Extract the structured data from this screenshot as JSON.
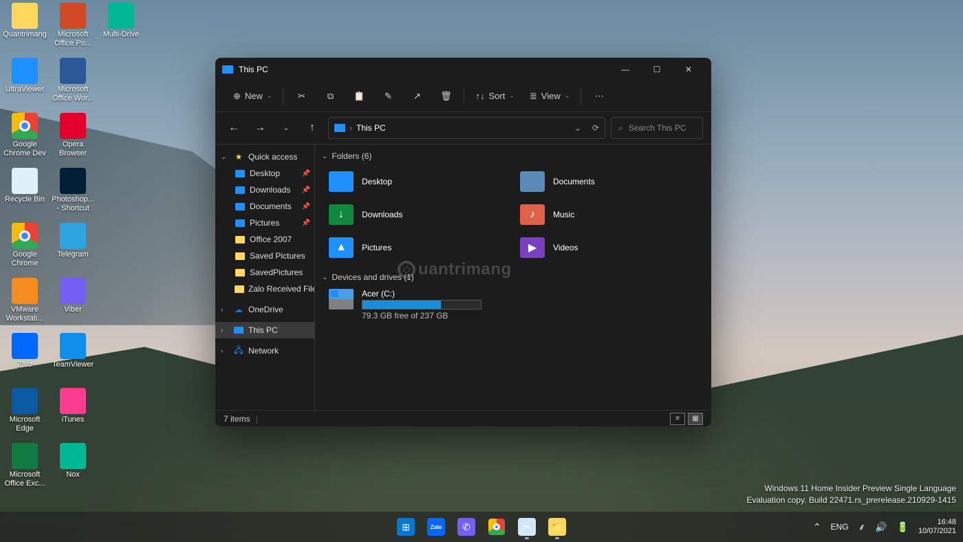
{
  "desktop_icons": [
    {
      "label": "Quantrimang",
      "col": 0,
      "row": 0,
      "color": "#ffd75e"
    },
    {
      "label": "Microsoft Office Po...",
      "col": 1,
      "row": 0,
      "color": "#d04a26"
    },
    {
      "label": "Multi-Drive",
      "col": 2,
      "row": 0,
      "color": "#00b894"
    },
    {
      "label": "UltraViewer",
      "col": 0,
      "row": 1,
      "color": "#1e90ff"
    },
    {
      "label": "Microsoft Office Wor...",
      "col": 1,
      "row": 1,
      "color": "#2b5797"
    },
    {
      "label": "Google Chrome Dev",
      "col": 0,
      "row": 2,
      "color": "chrome"
    },
    {
      "label": "Opera Browser",
      "col": 1,
      "row": 2,
      "color": "#e3002b"
    },
    {
      "label": "Recycle Bin",
      "col": 0,
      "row": 3,
      "color": "#e0f0f8"
    },
    {
      "label": "Photoshop... - Shortcut",
      "col": 1,
      "row": 3,
      "color": "#001e36"
    },
    {
      "label": "Google Chrome",
      "col": 0,
      "row": 4,
      "color": "chrome"
    },
    {
      "label": "Telegram",
      "col": 1,
      "row": 4,
      "color": "#2ca5e0"
    },
    {
      "label": "VMware Workstati...",
      "col": 0,
      "row": 5,
      "color": "#f68b1f"
    },
    {
      "label": "Viber",
      "col": 1,
      "row": 5,
      "color": "#7360f2"
    },
    {
      "label": "Zalo",
      "col": 0,
      "row": 6,
      "color": "#0068ff"
    },
    {
      "label": "TeamViewer",
      "col": 1,
      "row": 6,
      "color": "#0e8ee9"
    },
    {
      "label": "Microsoft Edge",
      "col": 0,
      "row": 7,
      "color": "#0c59a4"
    },
    {
      "label": "iTunes",
      "col": 1,
      "row": 7,
      "color": "#fc3c8f"
    },
    {
      "label": "Microsoft Office Exc...",
      "col": 0,
      "row": 8,
      "color": "#107c41"
    },
    {
      "label": "Nox",
      "col": 1,
      "row": 8,
      "color": "#00b894"
    }
  ],
  "explorer": {
    "title": "This PC",
    "toolbar": {
      "new": "New",
      "sort": "Sort",
      "view": "View"
    },
    "address": {
      "location": "This PC"
    },
    "search": {
      "placeholder": "Search This PC"
    },
    "nav": {
      "quick_access": "Quick access",
      "items": [
        {
          "label": "Desktop",
          "pinned": true,
          "color": "#1e90ff"
        },
        {
          "label": "Downloads",
          "pinned": true,
          "color": "#1e90ff",
          "glyph": "↓"
        },
        {
          "label": "Documents",
          "pinned": true,
          "color": "#1e90ff"
        },
        {
          "label": "Pictures",
          "pinned": true,
          "color": "#1e90ff"
        },
        {
          "label": "Office 2007",
          "pinned": false,
          "color": "#ffd75e"
        },
        {
          "label": "Saved Pictures",
          "pinned": false,
          "color": "#ffd75e"
        },
        {
          "label": "SavedPictures",
          "pinned": false,
          "color": "#ffd75e"
        },
        {
          "label": "Zalo Received Files",
          "pinned": false,
          "color": "#ffd75e"
        }
      ],
      "onedrive": "OneDrive",
      "thispc": "This PC",
      "network": "Network"
    },
    "groups": {
      "folders": {
        "label": "Folders (6)"
      },
      "drives": {
        "label": "Devices and drives (1)"
      }
    },
    "folders": [
      {
        "label": "Desktop",
        "color": "#1e90ff"
      },
      {
        "label": "Documents",
        "color": "#5a8ab8"
      },
      {
        "label": "Downloads",
        "color": "#10893e",
        "glyph": "↓"
      },
      {
        "label": "Music",
        "color": "#e0614a",
        "glyph": "♪"
      },
      {
        "label": "Pictures",
        "color": "#1e90ff",
        "glyph": "▲"
      },
      {
        "label": "Videos",
        "color": "#7a3fbf",
        "glyph": "▶"
      }
    ],
    "drive": {
      "label": "Acer (C:)",
      "free_text": "79.3 GB free of 237 GB",
      "used_pct": 66
    },
    "watermark": "uantrimang",
    "status": {
      "count": "7 items"
    }
  },
  "eval": {
    "line1": "Windows 11 Home Insider Preview Single Language",
    "line2": "Evaluation copy. Build 22471.rs_prerelease.210929-1415"
  },
  "taskbar": {
    "icons": [
      {
        "name": "start",
        "color": "#0078d4",
        "glyph": "⊞"
      },
      {
        "name": "zalo",
        "color": "#0068ff",
        "glyph": "Zalo",
        "text": true
      },
      {
        "name": "viber",
        "color": "#7360f2",
        "glyph": "✆"
      },
      {
        "name": "chrome",
        "color": "chrome",
        "glyph": ""
      },
      {
        "name": "snip",
        "color": "#d0e8f8",
        "glyph": "✂"
      },
      {
        "name": "explorer",
        "color": "#ffd75e",
        "glyph": "📁"
      }
    ]
  },
  "tray": {
    "lang": "ENG",
    "time": "16:48",
    "date": "10/07/2021"
  }
}
